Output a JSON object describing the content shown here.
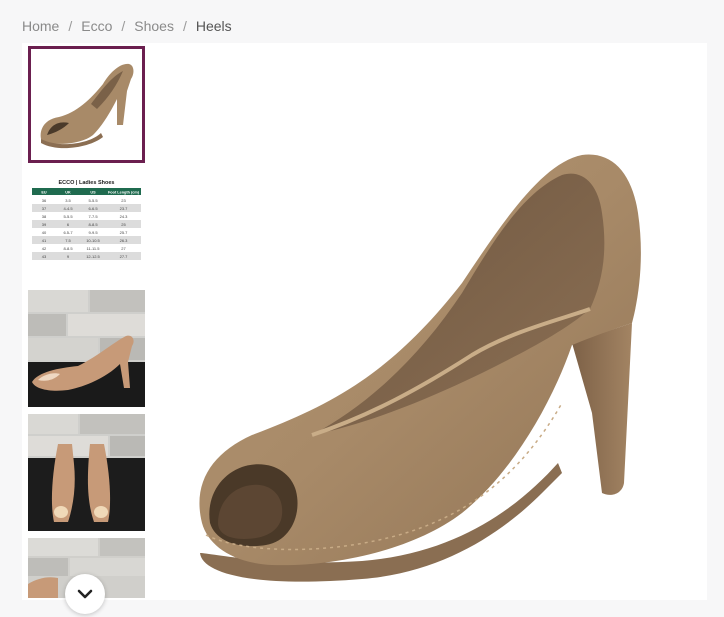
{
  "breadcrumb": {
    "items": [
      {
        "label": "Home"
      },
      {
        "label": "Ecco"
      },
      {
        "label": "Shoes"
      }
    ],
    "current": "Heels",
    "separator": "/"
  },
  "size_chart": {
    "title": "ECCO | Ladies Shoes",
    "headers": [
      "EU",
      "UK",
      "US",
      "Foot Length (cm)"
    ],
    "rows": [
      [
        "36",
        "3.5",
        "5-5.5",
        "23"
      ],
      [
        "37",
        "4-4.5",
        "6-6.5",
        "23.7"
      ],
      [
        "38",
        "5-5.5",
        "7-7.5",
        "24.3"
      ],
      [
        "39",
        "6",
        "8-8.5",
        "25"
      ],
      [
        "40",
        "6.5-7",
        "9-9.5",
        "25.7"
      ],
      [
        "41",
        "7.5",
        "10-10.5",
        "26.3"
      ],
      [
        "42",
        "8-8.5",
        "11-11.5",
        "27"
      ],
      [
        "43",
        "9",
        "12-12.5",
        "27.7"
      ]
    ]
  },
  "colors": {
    "accent": "#6b1f4f",
    "shoe": "#a88a68",
    "chart_header": "#1f6b4f"
  },
  "icons": {
    "scroll_down": "chevron-down-icon"
  }
}
